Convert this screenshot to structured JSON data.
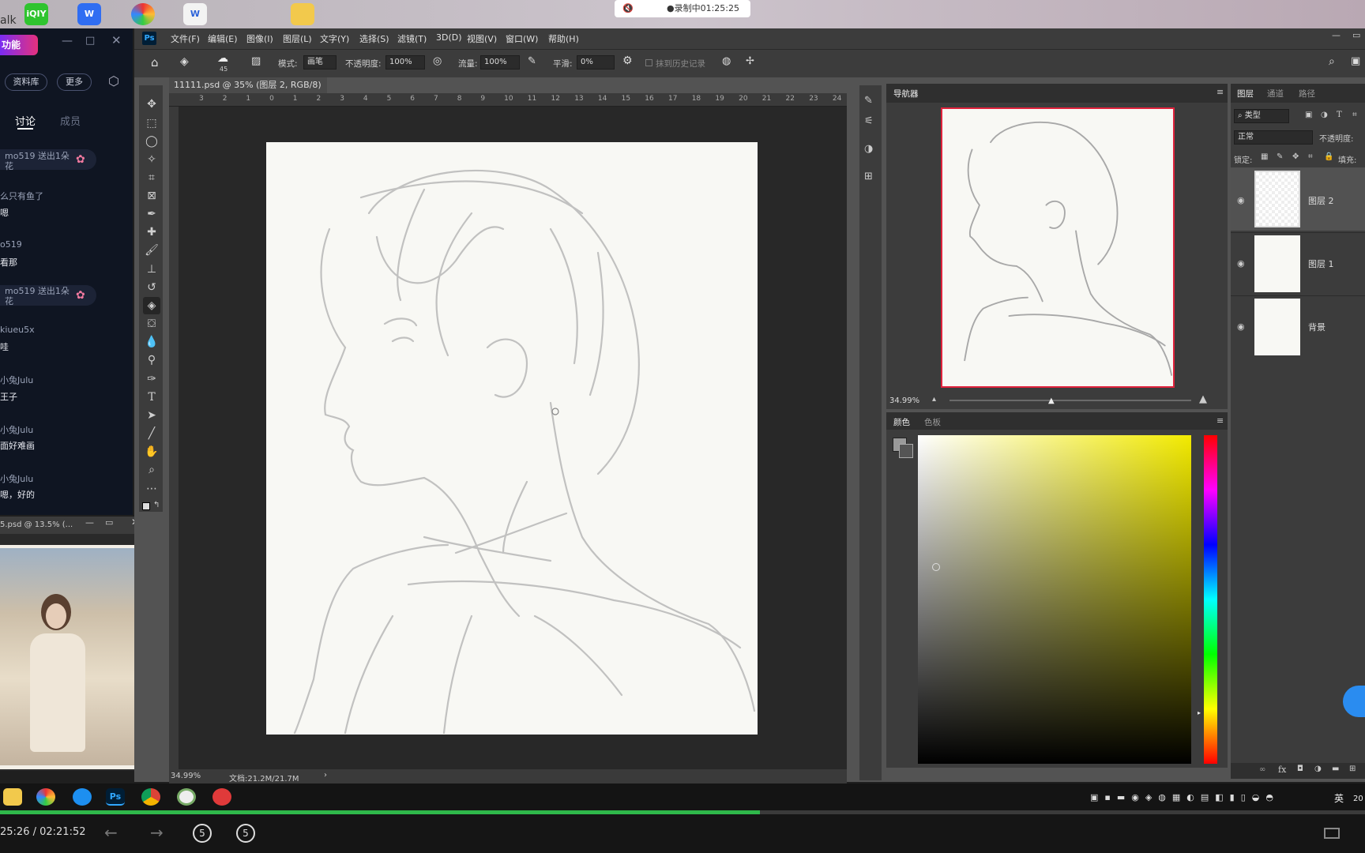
{
  "recording": {
    "label": "●录制中01:25:25"
  },
  "desktop": {
    "left_text": "alk",
    "icons": [
      "iQIYI",
      "W",
      "Chrome",
      "W",
      "folder"
    ]
  },
  "chat": {
    "title": "功能",
    "buttons": [
      "资料库",
      "更多"
    ],
    "tabs": [
      "讨论",
      "成员"
    ],
    "messages": [
      {
        "name": "mo519 送出1朵花",
        "text": "",
        "gift": true
      },
      {
        "name": "么只有鱼了",
        "text": "嗯",
        "gift": false
      },
      {
        "name": "o519",
        "text": "看那",
        "gift": false
      },
      {
        "name": "mo519 送出1朵花",
        "text": "",
        "gift": true
      },
      {
        "name": "kiueu5x",
        "text": "哇",
        "gift": false
      },
      {
        "name": "小兔Julu",
        "text": "王子",
        "gift": false
      },
      {
        "name": "小兔Julu",
        "text": "面好难画",
        "gift": false
      },
      {
        "name": "小兔Julu",
        "text": "嗯，好的",
        "gift": false
      }
    ]
  },
  "ps_mini_window": {
    "title": "5.psd @ 13.5% (..."
  },
  "photoshop": {
    "app_badge": "Ps",
    "menus": [
      "文件(F)",
      "编辑(E)",
      "图像(I)",
      "图层(L)",
      "文字(Y)",
      "选择(S)",
      "滤镜(T)",
      "3D(D)",
      "视图(V)",
      "窗口(W)",
      "帮助(H)"
    ],
    "options": {
      "brush_size": "45",
      "mode_label": "模式:",
      "mode_value": "画笔",
      "opacity_label": "不透明度:",
      "opacity_value": "100%",
      "flow_label": "流量:",
      "flow_value": "100%",
      "smooth_label": "平滑:",
      "smooth_value": "0%",
      "erase_history": "抹到历史记录"
    },
    "document_tab": "11111.psd @ 35% (图层 2, RGB/8) *",
    "ruler_numbers": [
      "3",
      "2",
      "1",
      "0",
      "1",
      "2",
      "3",
      "4",
      "5",
      "6",
      "7",
      "8",
      "9",
      "10",
      "11",
      "12",
      "13",
      "14",
      "15",
      "16",
      "17",
      "18",
      "19",
      "20",
      "21",
      "22",
      "23",
      "24"
    ],
    "status_zoom": "34.99%",
    "status_doc": "文档:21.2M/21.7M",
    "navigator": {
      "title": "导航器",
      "zoom": "34.99%"
    },
    "color": {
      "tabs": [
        "颜色",
        "色板"
      ]
    },
    "layers": {
      "tabs": [
        "图层",
        "通道",
        "路径"
      ],
      "filter_kind": "类型",
      "blend_mode": "正常",
      "opacity_label": "不透明度:",
      "lock_label": "锁定:",
      "fill_label": "填充:",
      "items": [
        {
          "name": "图层 2",
          "selected": true
        },
        {
          "name": "图层 1",
          "selected": false
        },
        {
          "name": "背景",
          "selected": false
        }
      ]
    }
  },
  "taskbar": {
    "lang": "英",
    "year": "20"
  },
  "player": {
    "time": "25:26 / 02:21:52",
    "progress": 0.557,
    "skip_back": "5",
    "skip_fwd": "5"
  }
}
